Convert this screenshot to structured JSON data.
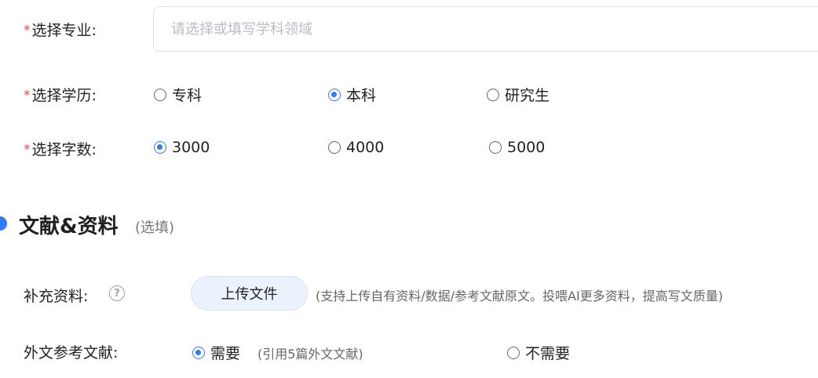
{
  "major": {
    "label": "选择专业:",
    "required_mark": "*",
    "placeholder": "请选择或填写学科领域",
    "value": ""
  },
  "degree": {
    "label": "选择学历:",
    "required_mark": "*",
    "options": [
      {
        "label": "专科",
        "checked": false
      },
      {
        "label": "本科",
        "checked": true
      },
      {
        "label": "研究生",
        "checked": false
      }
    ]
  },
  "word_count": {
    "label": "选择字数:",
    "required_mark": "*",
    "options": [
      {
        "label": "3000",
        "checked": true
      },
      {
        "label": "4000",
        "checked": false
      },
      {
        "label": "5000",
        "checked": false
      }
    ]
  },
  "section": {
    "title": "文献&资料",
    "subtitle": "(选填)"
  },
  "supplement": {
    "label": "补充资料:",
    "help_icon": "question-circle-icon",
    "upload_label": "上传文件",
    "hint": "(支持上传自有资料/数据/参考文献原文。投喂AI更多资料，提高写文质量)"
  },
  "foreign_refs": {
    "label": "外文参考文献:",
    "options": [
      {
        "label": "需要",
        "checked": true,
        "note": "(引用5篇外文文献)"
      },
      {
        "label": "不需要",
        "checked": false
      }
    ]
  },
  "colors": {
    "accent": "#2f7bf5",
    "required": "#e5484d"
  }
}
